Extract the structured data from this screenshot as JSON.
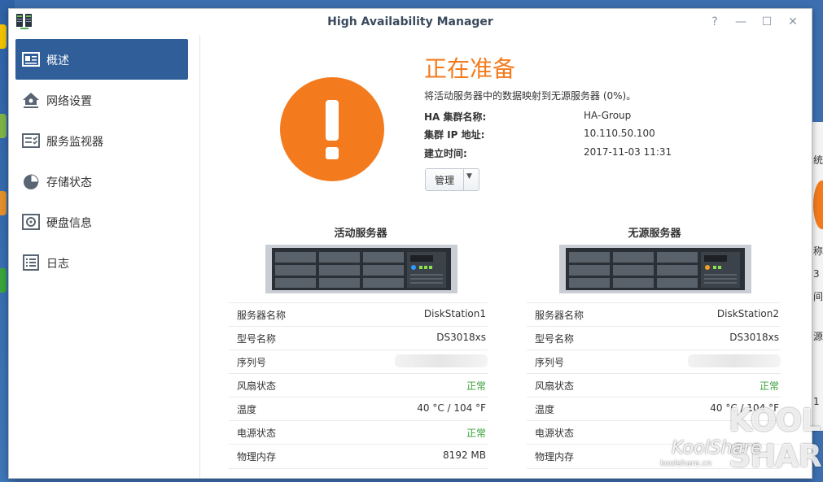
{
  "window": {
    "title": "High Availability Manager"
  },
  "sidebar": {
    "items": [
      {
        "label": "概述",
        "icon": "overview-card-icon",
        "active": true
      },
      {
        "label": "网络设置",
        "icon": "network-house-icon"
      },
      {
        "label": "服务监视器",
        "icon": "service-monitor-icon"
      },
      {
        "label": "存储状态",
        "icon": "storage-pie-icon"
      },
      {
        "label": "硬盘信息",
        "icon": "disk-icon"
      },
      {
        "label": "日志",
        "icon": "log-list-icon"
      }
    ]
  },
  "status": {
    "title": "正在准备",
    "description": "将活动服务器中的数据映射到无源服务器 (0%)。",
    "progress_percent": 0,
    "color": "#f37b1d",
    "info": [
      {
        "label": "HA 集群名称:",
        "value": "HA-Group"
      },
      {
        "label": "集群 IP 地址:",
        "value": "10.110.50.100"
      },
      {
        "label": "建立时间:",
        "value": "2017-11-03 11:31"
      }
    ],
    "manage_label": "管理"
  },
  "active_server": {
    "title": "活动服务器",
    "rows": [
      {
        "label": "服务器名称",
        "value": "DiskStation1"
      },
      {
        "label": "型号名称",
        "value": "DS3018xs"
      },
      {
        "label": "序列号",
        "value": ""
      },
      {
        "label": "风扇状态",
        "value": "正常",
        "status": "ok"
      },
      {
        "label": "温度",
        "value": "40 °C / 104 °F"
      },
      {
        "label": "电源状态",
        "value": "正常",
        "status": "ok"
      },
      {
        "label": "物理内存",
        "value": "8192 MB"
      }
    ]
  },
  "passive_server": {
    "title": "无源服务器",
    "rows": [
      {
        "label": "服务器名称",
        "value": "DiskStation2"
      },
      {
        "label": "型号名称",
        "value": "DS3018xs"
      },
      {
        "label": "序列号",
        "value": ""
      },
      {
        "label": "风扇状态",
        "value": "正常",
        "status": "ok"
      },
      {
        "label": "温度",
        "value": "40 °C / 104 °F"
      },
      {
        "label": "电源状态",
        "value": ""
      },
      {
        "label": "物理内存",
        "value": ""
      }
    ]
  },
  "watermark": {
    "brand": "KoolShare",
    "url": "koolshare.cn",
    "logo_top": "KOOL",
    "logo_bottom": "SHARE"
  },
  "desktop_right_fragments": [
    "统",
    "称",
    "3",
    "间",
    "源",
    "1"
  ],
  "colors": {
    "accent": "#2f5e99",
    "warning": "#f37b1d",
    "ok": "#3aa23a"
  }
}
